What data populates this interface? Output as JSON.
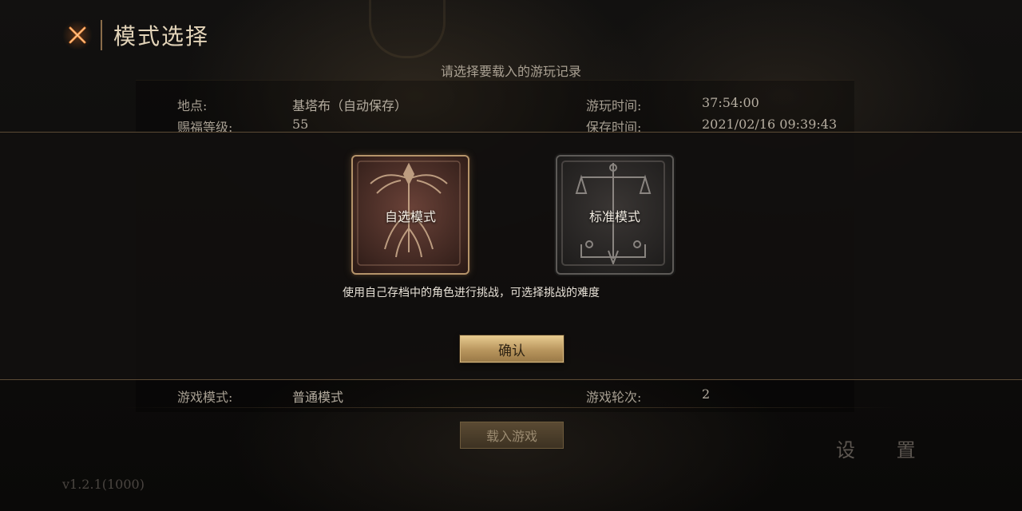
{
  "header": {
    "title": "模式选择",
    "close_icon": "close-x-icon"
  },
  "record": {
    "prompt": "请选择要载入的游玩记录",
    "row1": [
      {
        "label": "地点:",
        "value": "基塔布（自动保存）"
      },
      {
        "label": "游玩时间:",
        "value": "37:54:00"
      }
    ],
    "row2": [
      {
        "label": "赐福等级:",
        "value": "55"
      },
      {
        "label": "保存时间:",
        "value": "2021/02/16 09:39:43"
      }
    ],
    "row3": [
      {
        "label": "游戏模式:",
        "value": "普通模式"
      },
      {
        "label": "游戏轮次:",
        "value": "2"
      }
    ],
    "load_button": "载入游戏"
  },
  "settings_label": "设 置",
  "version": "v1.2.1(1000)",
  "modal": {
    "modes": [
      {
        "label": "自选模式",
        "selected": true
      },
      {
        "label": "标准模式",
        "selected": false
      }
    ],
    "description": "使用自己存档中的角色进行挑战，可选择挑战的难度",
    "confirm_button": "确认"
  },
  "colors": {
    "accent_gold": "#d9bb82",
    "modal_bg": "#12100e",
    "title": "#e2d3b8"
  }
}
